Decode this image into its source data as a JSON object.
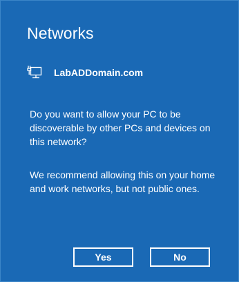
{
  "panel": {
    "title": "Networks",
    "network_icon": "wired-network-icon",
    "network_name": "LabADDomain.com",
    "question": "Do you want to allow your PC to be discoverable by other PCs and devices on this network?",
    "recommendation": "We recommend allowing this on your home and work networks, but not public ones.",
    "yes_label": "Yes",
    "no_label": "No"
  },
  "colors": {
    "background": "#1a69b5",
    "text": "#ffffff"
  }
}
